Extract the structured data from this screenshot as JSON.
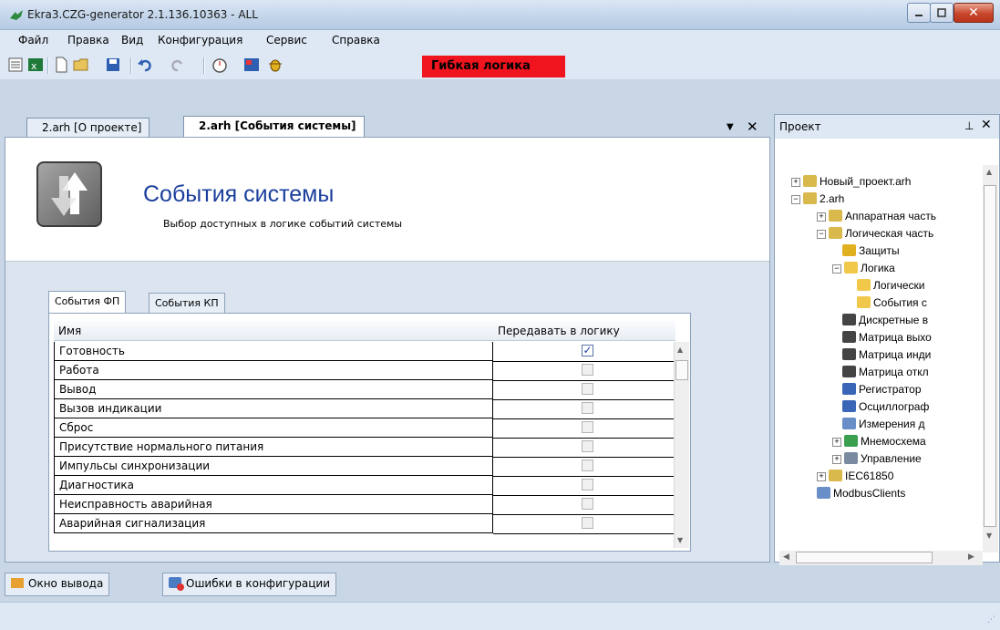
{
  "window": {
    "title": "Ekra3.CZG-generator 2.1.136.10363 - ALL"
  },
  "menu": [
    "Файл",
    "Правка",
    "Вид",
    "Конфигурация",
    "Сервис",
    "Справка"
  ],
  "toolbar": {
    "logic_button": "Гибкая логика"
  },
  "doc_tabs": [
    {
      "label": "2.arh [О проекте]",
      "active": false
    },
    {
      "label": "2.arh [События системы]",
      "active": true
    }
  ],
  "doc": {
    "title": "События системы",
    "subtitle": "Выбор доступных в логике событий системы",
    "sub_tabs": [
      "События ФП",
      "События КП"
    ],
    "grid": {
      "columns": [
        "Имя",
        "Передавать в логику"
      ],
      "rows": [
        {
          "name": "Готовность",
          "checked": true
        },
        {
          "name": "Работа",
          "checked": false
        },
        {
          "name": "Вывод",
          "checked": false
        },
        {
          "name": "Вызов индикации",
          "checked": false
        },
        {
          "name": "Сброс",
          "checked": false
        },
        {
          "name": "Присутствие нормального питания",
          "checked": false
        },
        {
          "name": "Импульсы синхронизации",
          "checked": false
        },
        {
          "name": "Диагностика",
          "checked": false
        },
        {
          "name": "Неисправность аварийная",
          "checked": false
        },
        {
          "name": "Аварийная сигнализация",
          "checked": false
        }
      ]
    }
  },
  "project": {
    "title": "Проект",
    "tree": [
      {
        "label": "Новый_проект.arh",
        "icon": "folder-icon"
      },
      {
        "label": "2.arh",
        "icon": "folder-icon"
      },
      {
        "label": "Аппаратная часть",
        "icon": "folder-icon"
      },
      {
        "label": "Логическая часть",
        "icon": "folder-icon"
      },
      {
        "label": "Защиты",
        "icon": "key-icon"
      },
      {
        "label": "Логика",
        "icon": "logic-icon"
      },
      {
        "label": "Логически",
        "icon": "logic-icon"
      },
      {
        "label": "События с",
        "icon": "logic-icon"
      },
      {
        "label": "Дискретные в",
        "icon": "matrix-icon"
      },
      {
        "label": "Матрица выхо",
        "icon": "matrix-icon"
      },
      {
        "label": "Матрица инди",
        "icon": "matrix-icon"
      },
      {
        "label": "Матрица откл",
        "icon": "matrix-icon"
      },
      {
        "label": "Регистратор",
        "icon": "recorder-icon"
      },
      {
        "label": "Осциллограф",
        "icon": "recorder-icon"
      },
      {
        "label": "Измерения д",
        "icon": "measure-icon"
      },
      {
        "label": "Мнемосхема",
        "icon": "mnemo-icon"
      },
      {
        "label": "Управление",
        "icon": "control-icon"
      },
      {
        "label": "IEC61850",
        "icon": "folder-icon"
      },
      {
        "label": "ModbusClients",
        "icon": "module-icon"
      }
    ]
  },
  "bottom_tabs": [
    "Окно вывода",
    "Ошибки в конфигурации"
  ]
}
